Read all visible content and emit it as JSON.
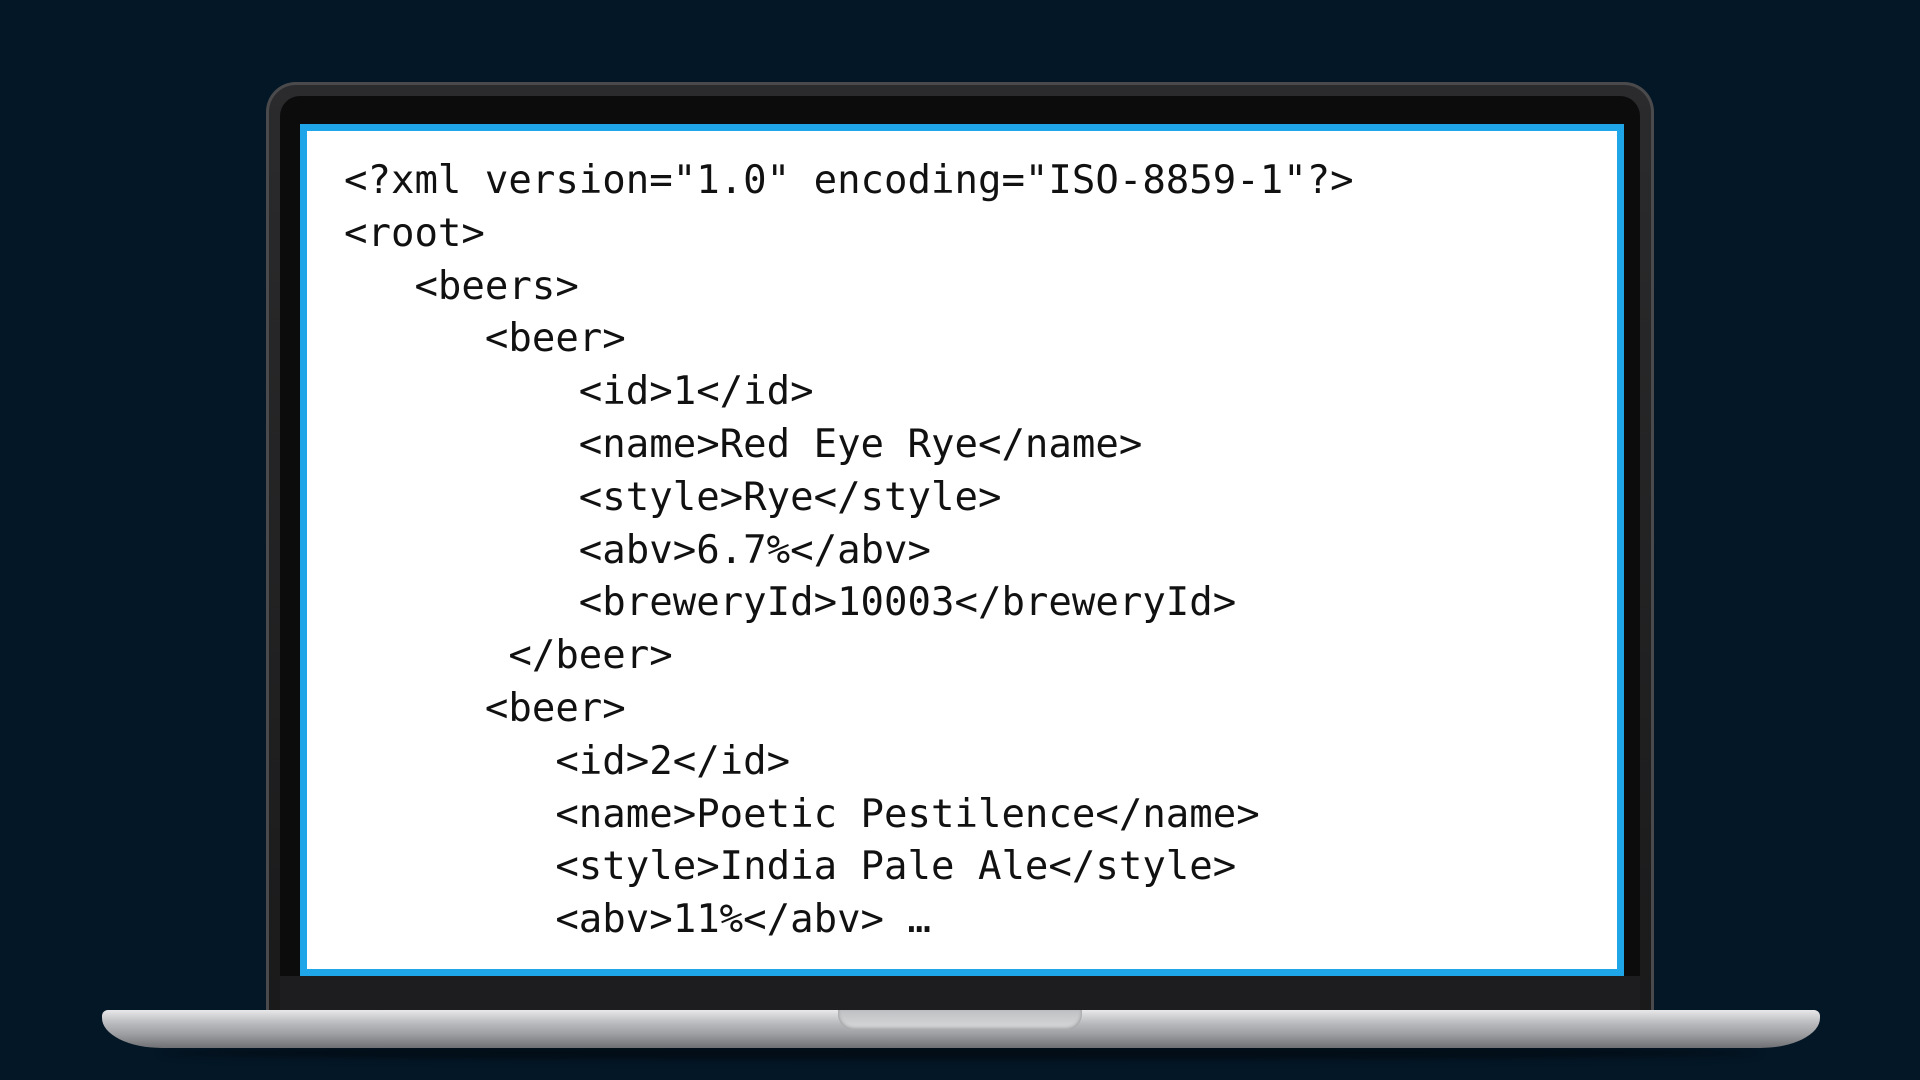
{
  "editor": {
    "lines": [
      "<?xml version=\"1.0\" encoding=\"ISO-8859-1\"?>",
      "<root>",
      "   <beers>",
      "      <beer>",
      "          <id>1</id>",
      "          <name>Red Eye Rye</name>",
      "          <style>Rye</style>",
      "          <abv>6.7%</abv>",
      "          <breweryId>10003</breweryId>",
      "       </beer>",
      "      <beer>",
      "         <id>2</id>",
      "         <name>Poetic Pestilence</name>",
      "         <style>India Pale Ale</style>",
      "         <abv>11%</abv> …"
    ]
  },
  "colors": {
    "background": "#041727",
    "screen_border": "#1ea6e8",
    "screen_background": "#ffffff",
    "text": "#111111"
  }
}
